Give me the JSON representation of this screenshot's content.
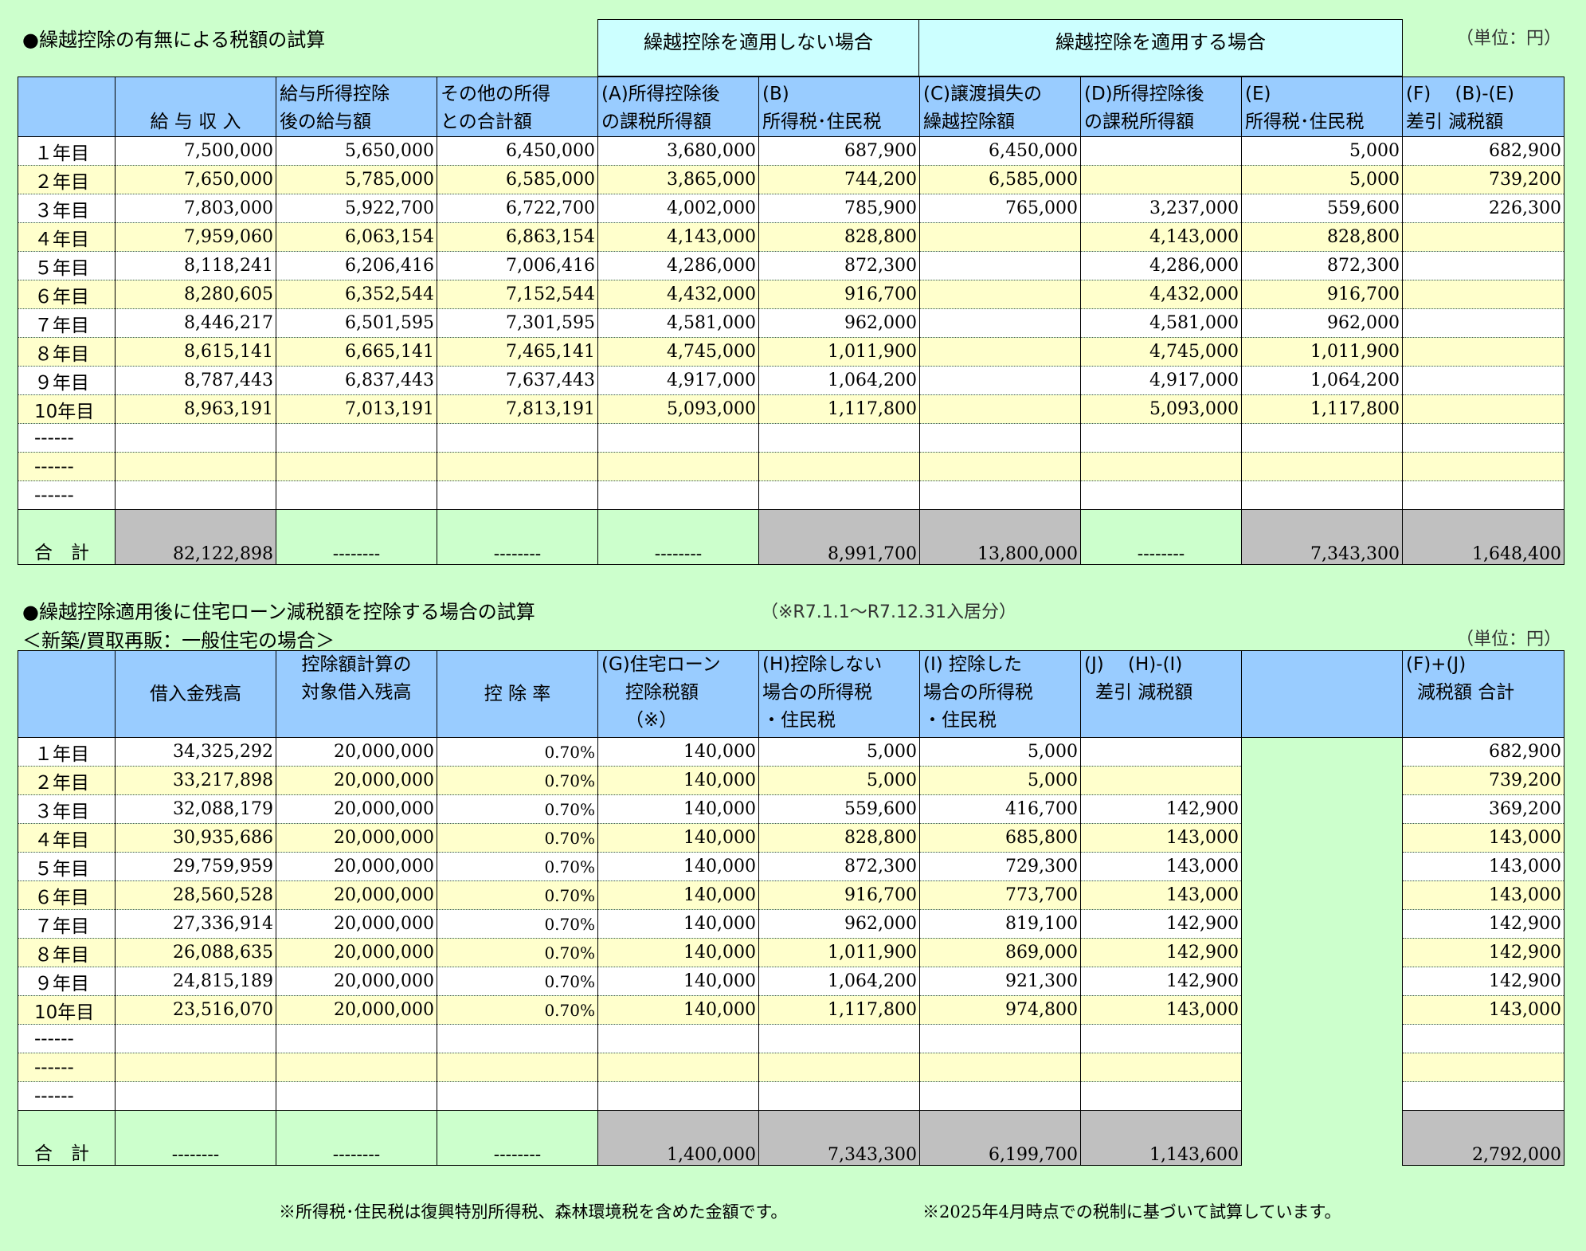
{
  "section1": {
    "title": "●繰越控除の有無による税額の試算",
    "group_no_apply": "繰越控除を適用しない場合",
    "group_apply": "繰越控除を適用する場合",
    "unit": "（単位：円）",
    "headers": [
      [
        "",
        ""
      ],
      [
        "",
        "給 与 収 入"
      ],
      [
        "給与所得控除",
        "後の給与額"
      ],
      [
        "その他の所得",
        "との合計額"
      ],
      [
        "(A)所得控除後",
        "の課税所得額"
      ],
      [
        "(B)",
        "所得税･住民税"
      ],
      [
        "(C)譲渡損失の",
        "繰越控除額"
      ],
      [
        "(D)所得控除後",
        "の課税所得額"
      ],
      [
        "(E)",
        "所得税･住民税"
      ],
      [
        "(F)　 (B)-(E)",
        "差引 減税額"
      ]
    ],
    "rows": [
      [
        "１年目",
        "7,500,000",
        "5,650,000",
        "6,450,000",
        "3,680,000",
        "687,900",
        "6,450,000",
        "",
        "5,000",
        "682,900"
      ],
      [
        "２年目",
        "7,650,000",
        "5,785,000",
        "6,585,000",
        "3,865,000",
        "744,200",
        "6,585,000",
        "",
        "5,000",
        "739,200"
      ],
      [
        "３年目",
        "7,803,000",
        "5,922,700",
        "6,722,700",
        "4,002,000",
        "785,900",
        "765,000",
        "3,237,000",
        "559,600",
        "226,300"
      ],
      [
        "４年目",
        "7,959,060",
        "6,063,154",
        "6,863,154",
        "4,143,000",
        "828,800",
        "",
        "4,143,000",
        "828,800",
        ""
      ],
      [
        "５年目",
        "8,118,241",
        "6,206,416",
        "7,006,416",
        "4,286,000",
        "872,300",
        "",
        "4,286,000",
        "872,300",
        ""
      ],
      [
        "６年目",
        "8,280,605",
        "6,352,544",
        "7,152,544",
        "4,432,000",
        "916,700",
        "",
        "4,432,000",
        "916,700",
        ""
      ],
      [
        "７年目",
        "8,446,217",
        "6,501,595",
        "7,301,595",
        "4,581,000",
        "962,000",
        "",
        "4,581,000",
        "962,000",
        ""
      ],
      [
        "８年目",
        "8,615,141",
        "6,665,141",
        "7,465,141",
        "4,745,000",
        "1,011,900",
        "",
        "4,745,000",
        "1,011,900",
        ""
      ],
      [
        "９年目",
        "8,787,443",
        "6,837,443",
        "7,637,443",
        "4,917,000",
        "1,064,200",
        "",
        "4,917,000",
        "1,064,200",
        ""
      ],
      [
        "10年目",
        "8,963,191",
        "7,013,191",
        "7,813,191",
        "5,093,000",
        "1,117,800",
        "",
        "5,093,000",
        "1,117,800",
        ""
      ],
      [
        "------",
        "",
        "",
        "",
        "",
        "",
        "",
        "",
        "",
        ""
      ],
      [
        "------",
        "",
        "",
        "",
        "",
        "",
        "",
        "",
        "",
        ""
      ],
      [
        "------",
        "",
        "",
        "",
        "",
        "",
        "",
        "",
        "",
        ""
      ]
    ],
    "total": [
      "合　計",
      "82,122,898",
      "--------",
      "--------",
      "--------",
      "8,991,700",
      "13,800,000",
      "--------",
      "7,343,300",
      "1,648,400"
    ]
  },
  "section2": {
    "title": "●繰越控除適用後に住宅ローン減税額を控除する場合の試算",
    "note": "（※R7.1.1～R7.12.31入居分）",
    "subtitle": "＜新築/買取再販：一般住宅の場合＞",
    "unit": "（単位：円）",
    "headers": [
      [
        "",
        "",
        ""
      ],
      [
        "",
        "借入金残高",
        ""
      ],
      [
        "控除額計算の",
        "対象借入残高",
        ""
      ],
      [
        "",
        "控 除 率",
        ""
      ],
      [
        "(G)住宅ローン",
        "控除税額",
        "（※）"
      ],
      [
        "(H)控除しない",
        "場合の所得税",
        "・住民税"
      ],
      [
        "(I) 控除した",
        "場合の所得税",
        "・住民税"
      ],
      [
        "(J)　 (H)-(I)",
        "差引 減税額",
        ""
      ],
      [
        "",
        "",
        ""
      ],
      [
        "(F)+(J)",
        "減税額 合計",
        ""
      ]
    ],
    "rows": [
      [
        "１年目",
        "34,325,292",
        "20,000,000",
        "0.70%",
        "140,000",
        "5,000",
        "5,000",
        "",
        "682,900"
      ],
      [
        "２年目",
        "33,217,898",
        "20,000,000",
        "0.70%",
        "140,000",
        "5,000",
        "5,000",
        "",
        "739,200"
      ],
      [
        "３年目",
        "32,088,179",
        "20,000,000",
        "0.70%",
        "140,000",
        "559,600",
        "416,700",
        "142,900",
        "369,200"
      ],
      [
        "４年目",
        "30,935,686",
        "20,000,000",
        "0.70%",
        "140,000",
        "828,800",
        "685,800",
        "143,000",
        "143,000"
      ],
      [
        "５年目",
        "29,759,959",
        "20,000,000",
        "0.70%",
        "140,000",
        "872,300",
        "729,300",
        "143,000",
        "143,000"
      ],
      [
        "６年目",
        "28,560,528",
        "20,000,000",
        "0.70%",
        "140,000",
        "916,700",
        "773,700",
        "143,000",
        "143,000"
      ],
      [
        "７年目",
        "27,336,914",
        "20,000,000",
        "0.70%",
        "140,000",
        "962,000",
        "819,100",
        "142,900",
        "142,900"
      ],
      [
        "８年目",
        "26,088,635",
        "20,000,000",
        "0.70%",
        "140,000",
        "1,011,900",
        "869,000",
        "142,900",
        "142,900"
      ],
      [
        "９年目",
        "24,815,189",
        "20,000,000",
        "0.70%",
        "140,000",
        "1,064,200",
        "921,300",
        "142,900",
        "142,900"
      ],
      [
        "10年目",
        "23,516,070",
        "20,000,000",
        "0.70%",
        "140,000",
        "1,117,800",
        "974,800",
        "143,000",
        "143,000"
      ],
      [
        "------",
        "",
        "",
        "",
        "",
        "",
        "",
        "",
        ""
      ],
      [
        "------",
        "",
        "",
        "",
        "",
        "",
        "",
        "",
        ""
      ],
      [
        "------",
        "",
        "",
        "",
        "",
        "",
        "",
        "",
        ""
      ]
    ],
    "total": [
      "合　計",
      "--------",
      "--------",
      "--------",
      "1,400,000",
      "7,343,300",
      "6,199,700",
      "1,143,600",
      "2,792,000"
    ]
  },
  "footnotes": {
    "left": "※所得税･住民税は復興特別所得税、森林環境税を含めた金額です。",
    "right": "※2025年4月時点での税制に基づいて試算しています。"
  }
}
